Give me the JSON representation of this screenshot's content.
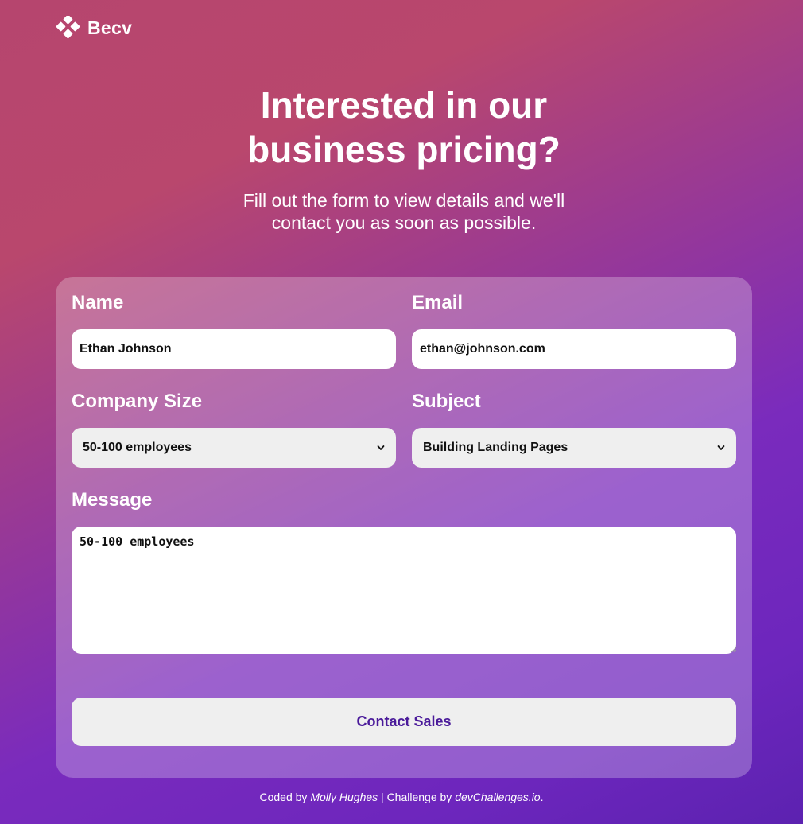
{
  "brand": {
    "name": "Becv"
  },
  "hero": {
    "title": "Interested in our business pricing?",
    "subtitle": "Fill out the form to view details and we'll contact you as soon as possible."
  },
  "form": {
    "name_label": "Name",
    "name_value": "Ethan Johnson",
    "email_label": "Email",
    "email_value": "ethan@johnson.com",
    "company_size_label": "Company Size",
    "company_size_value": "50-100 employees",
    "subject_label": "Subject",
    "subject_value": "Building Landing Pages",
    "message_label": "Message",
    "message_value": "50-100 employees",
    "submit_label": "Contact Sales"
  },
  "footer": {
    "prefix": "Coded by ",
    "author": "Molly Hughes",
    "separator": " | Challenge by ",
    "site": "devChallenges.io",
    "suffix": "."
  },
  "colors": {
    "background_start": "#b6456e",
    "background_end": "#5c22b0",
    "button_text": "#4a1a9a",
    "input_background": "#ffffff",
    "select_background": "#efefef"
  },
  "icons": {
    "logo": "diamond-cluster-icon",
    "select_arrow": "chevron-down-icon"
  }
}
